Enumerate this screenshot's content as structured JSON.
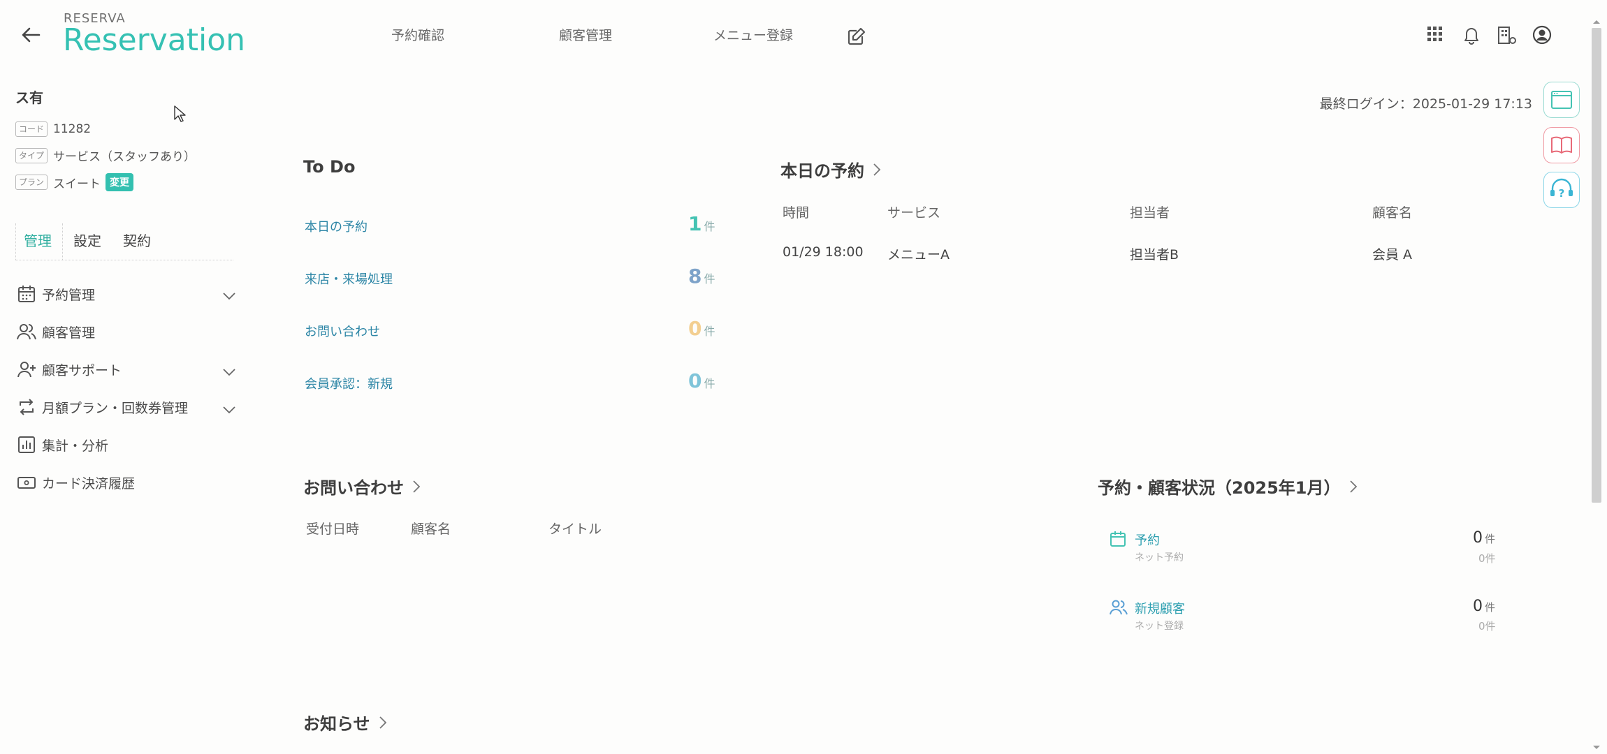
{
  "header": {
    "brand_top": "RESERVA",
    "brand_main": "Reservation",
    "nav": [
      "予約確認",
      "顧客管理",
      "メニュー登録"
    ]
  },
  "sidebar": {
    "shop_name": "ス有",
    "code_tag": "コード",
    "code_value": "11282",
    "type_tag": "タイプ",
    "type_value": "サービス（スタッフあり）",
    "plan_tag": "プラン",
    "plan_value": "スイート",
    "plan_change": "変更",
    "tabs": [
      "管理",
      "設定",
      "契約"
    ],
    "items": [
      {
        "label": "予約管理"
      },
      {
        "label": "顧客管理"
      },
      {
        "label": "顧客サポート"
      },
      {
        "label": "月額プラン・回数券管理"
      },
      {
        "label": "集計・分析"
      },
      {
        "label": "カード決済履歴"
      }
    ]
  },
  "last_login": "最終ログイン：2025-01-29 17:13",
  "todo": {
    "title": "To Do",
    "unit": "件",
    "items": [
      {
        "label": "本日の予約",
        "count": "1",
        "color": "#45c3b3"
      },
      {
        "label": "来店・来場処理",
        "count": "8",
        "color": "#7ea3c9"
      },
      {
        "label": "お問い合わせ",
        "count": "0",
        "color": "#f3cf91"
      },
      {
        "label": "会員承認：新規",
        "count": "0",
        "color": "#7fc4d9"
      }
    ]
  },
  "today": {
    "title": "本日の予約",
    "headers": [
      "時間",
      "サービス",
      "担当者",
      "顧客名"
    ],
    "rows": [
      [
        "01/29 18:00",
        "メニューA",
        "担当者B",
        "会員 A"
      ]
    ]
  },
  "inquiry": {
    "title": "お問い合わせ",
    "headers": [
      "受付日時",
      "顧客名",
      "タイトル"
    ]
  },
  "status": {
    "title": "予約・顧客状況（2025年1月）",
    "unit": "件",
    "items": [
      {
        "label": "予約",
        "sub": "ネット予約",
        "count": "0",
        "sub_count": "0件"
      },
      {
        "label": "新規顧客",
        "sub": "ネット登録",
        "count": "0",
        "sub_count": "0件"
      }
    ]
  },
  "notice": {
    "title": "お知らせ"
  },
  "colors": {
    "accent": "#35c1b3",
    "link": "#2d86a6"
  }
}
